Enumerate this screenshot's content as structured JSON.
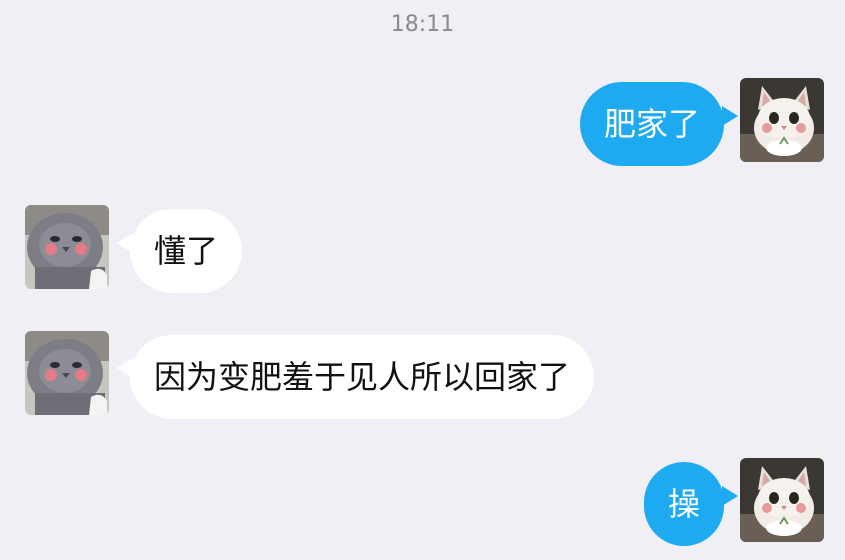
{
  "chat": {
    "timestamp": "18:11",
    "messages": [
      {
        "side": "outgoing",
        "text": "肥家了",
        "avatar_icon": "cat-avatar-icon"
      },
      {
        "side": "incoming",
        "text": "懂了",
        "avatar_icon": "gray-cat-avatar-icon"
      },
      {
        "side": "incoming",
        "text": "因为变肥羞于见人所以回家了",
        "avatar_icon": "gray-cat-avatar-icon"
      },
      {
        "side": "outgoing",
        "text": "操",
        "avatar_icon": "cat-avatar-icon"
      }
    ]
  },
  "colors": {
    "background": "#efeff5",
    "outgoing_bubble": "#1eaaf1",
    "incoming_bubble": "#ffffff"
  }
}
